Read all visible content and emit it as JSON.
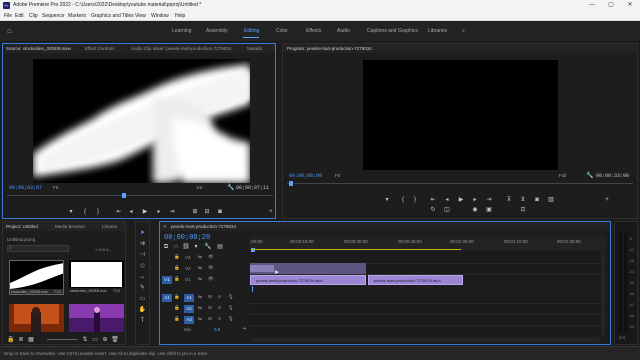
{
  "titlebar": {
    "app_logo": "Pr",
    "title": "Adobe Premiere Pro 2022 - C:\\Users\\2022\\Desktop\\youtube material\\prproj\\Untitled *",
    "minimize": "—",
    "maximize": "▢",
    "close": "✕"
  },
  "menubar": {
    "items": [
      "File",
      "Edit",
      "Clip",
      "Sequence",
      "Markers",
      "Graphics and Titles",
      "View",
      "Window",
      "Help"
    ]
  },
  "workspaces": {
    "tabs": [
      "Learning",
      "Assembly",
      "Editing",
      "Color",
      "Effects",
      "Audio",
      "Captions and Graphics",
      "Libraries"
    ],
    "active": "Editing",
    "more": "»"
  },
  "source_panel": {
    "tabs": [
      "Source: stockvideo_02049t.mxw",
      "Effect Controls",
      "Audio Clip Mixer: pexels-mart-production-7279034",
      "Metada"
    ],
    "timecode_in": "00;00;03;07",
    "fit": "Fit",
    "resolution": "1/2",
    "timecode_out": "00;00;07;11",
    "accent_color": "#3a7ad8"
  },
  "program_panel": {
    "tabs": [
      "Program: pexels-mart-production-7279034"
    ],
    "timecode_in": "00;00;00;00",
    "fit": "Fit",
    "resolution": "Full",
    "timecode_out": "00:00:33:00"
  },
  "project_panel": {
    "tabs": [
      "Project: Untitled",
      "Media Browser",
      "Librarie"
    ],
    "file": "Untitled.prproj",
    "item_count": "1 of 6 it...",
    "thumbnails": [
      {
        "name": "stockvideo_02049t.mov",
        "duration": "7;10"
      },
      {
        "name": "stockvideo_02043t.mov",
        "duration": "7;10"
      },
      {
        "name": "",
        "duration": ""
      },
      {
        "name": "",
        "duration": ""
      }
    ]
  },
  "timeline": {
    "tab": "pexels-mart-production-7279034",
    "timecode": "00;00;00;20",
    "ruler_labels": [
      ":00:00",
      "00:00:15:00",
      "00:00:30:00",
      "00:00:45:00",
      "00:01:00:00",
      "00:01:15:00",
      "00:01:30:00"
    ],
    "video_tracks": [
      "V3",
      "V2",
      "V1"
    ],
    "audio_tracks": [
      "A1",
      "A2",
      "A3"
    ],
    "source_patch_v": "V1",
    "source_patch_a": "A1",
    "mix_label": "Mix",
    "mix_value": "0.0",
    "clips": [
      {
        "track": "V1",
        "label": "pexels-mart-production-7279034.mp4"
      },
      {
        "track": "V1",
        "label": "pexels-mart-production-7279020.mp4"
      }
    ],
    "tooltip": "+00:00:00:00",
    "clip_color": "#9b86d6",
    "clip_color_light": "#b9a9ea"
  },
  "meters": {
    "labels": [
      "-6",
      "-12",
      "-18",
      "-24",
      "-30",
      "-36",
      "-42",
      "-48",
      "-54"
    ],
    "solo": "S S"
  },
  "statusbar": {
    "text": "Drop in track to Overwrite. Use Ctrl to enable Insert. Use Alt to duplicate clip. Use Shift to jsn in a track."
  }
}
